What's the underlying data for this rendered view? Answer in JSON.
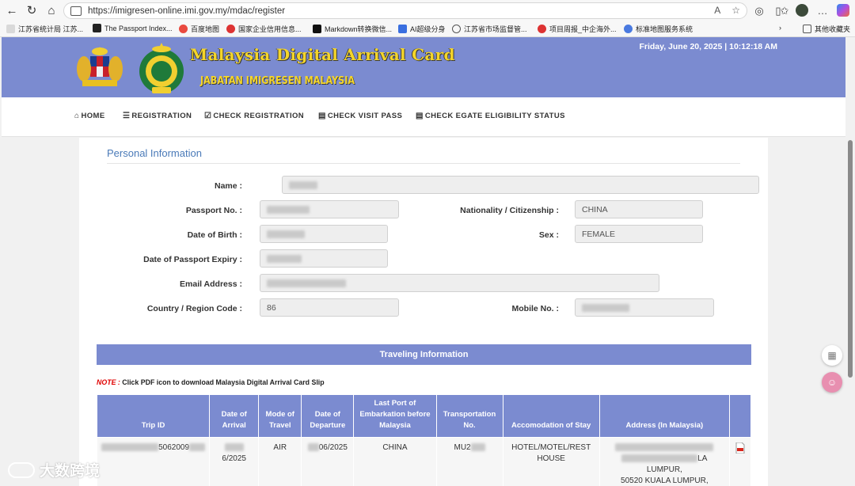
{
  "browser": {
    "url": "https://imigresen-online.imi.gov.my/mdac/register",
    "bookmarks": [
      "江苏省统计局 江苏...",
      "The Passport Index...",
      "百度地图",
      "国家企业信用信息...",
      "Markdown转换微信...",
      "AI超级分身",
      "江苏省市场监督管...",
      "项目周报_中企海外...",
      "标准地图服务系统",
      "其他收藏夹"
    ]
  },
  "header": {
    "title": "Malaysia Digital Arrival Card",
    "subtitle": "JABATAN IMIGRESEN MALAYSIA",
    "datetime": "Friday, June 20, 2025 | 10:12:18 AM"
  },
  "nav": {
    "home": "HOME",
    "registration": "REGISTRATION",
    "check_registration": "CHECK REGISTRATION",
    "check_visit_pass": "CHECK VISIT PASS",
    "check_egate": "CHECK EGATE ELIGIBILITY STATUS"
  },
  "personal": {
    "section_title": "Personal Information",
    "name_label": "Name :",
    "passport_label": "Passport No. :",
    "nationality_label": "Nationality / Citizenship :",
    "nationality_value": "CHINA",
    "dob_label": "Date of Birth :",
    "sex_label": "Sex :",
    "sex_value": "FEMALE",
    "expiry_label": "Date of Passport Expiry :",
    "email_label": "Email Address :",
    "country_code_label": "Country / Region Code :",
    "country_code_value": "86",
    "mobile_label": "Mobile No. :"
  },
  "travel": {
    "section_title": "Traveling Information",
    "note_label": "NOTE :",
    "note_text": "Click PDF icon to download Malaysia Digital Arrival Card Slip",
    "columns": [
      "Trip ID",
      "Date of Arrival",
      "Mode of Travel",
      "Date of Departure",
      "Last Port of Embarkation before Malaysia",
      "Transportation No.",
      "Accomodation of Stay",
      "Address (In Malaysia)"
    ],
    "row": {
      "trip_id_suffix": "5062009",
      "arrival_suffix": "6/2025",
      "mode": "AIR",
      "departure_suffix": "06/2025",
      "last_port": "CHINA",
      "transport_prefix": "MU2",
      "accommodation": "HOTEL/MOTEL/REST HOUSE",
      "address_line1": "LA",
      "address_line2": "LUMPUR,",
      "address_line3": "50520  KUALA LUMPUR,"
    }
  },
  "watermark": "大数跨境"
}
